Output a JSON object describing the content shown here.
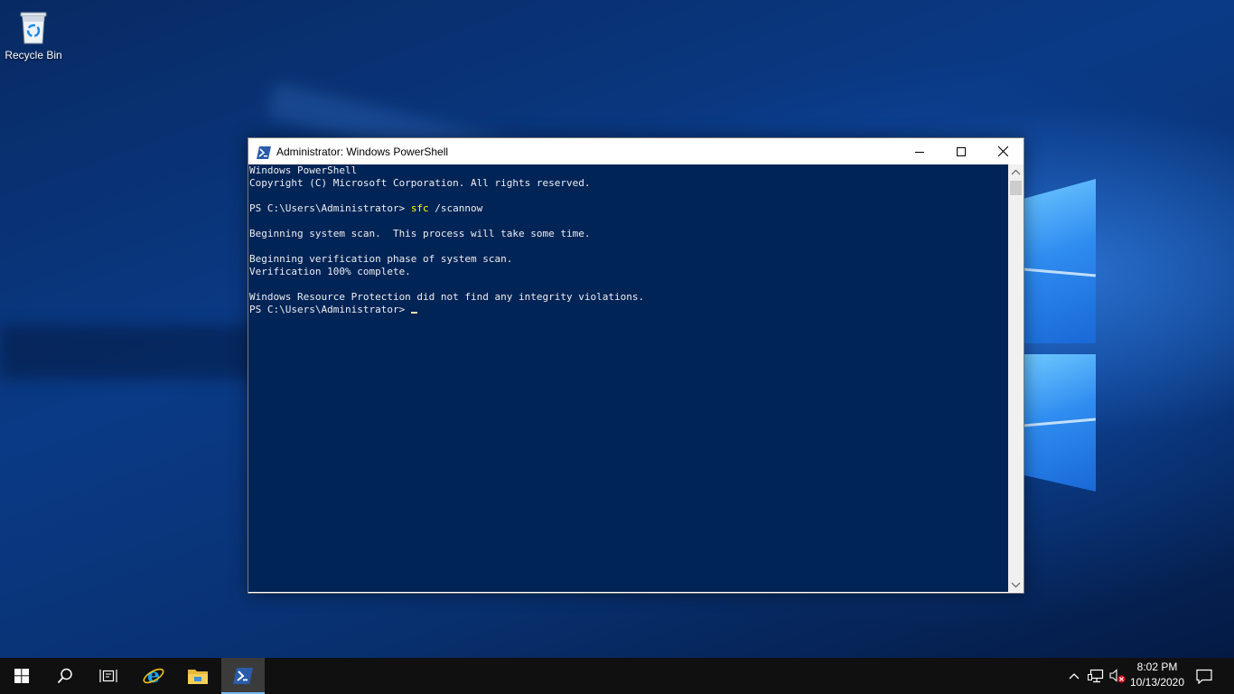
{
  "desktop": {
    "icons": [
      {
        "label": "Recycle Bin",
        "icon": "recycle-bin-icon"
      }
    ]
  },
  "window": {
    "title": "Administrator: Windows PowerShell",
    "icon": "powershell-icon",
    "controls": {
      "minimize": "minimize-icon",
      "maximize": "maximize-icon",
      "close": "close-icon"
    },
    "console": {
      "background": "#012456",
      "foreground": "#eeedf0",
      "command_color": "#ffff00",
      "lines": [
        "Windows PowerShell",
        "Copyright (C) Microsoft Corporation. All rights reserved.",
        "",
        "",
        "",
        "Beginning system scan.  This process will take some time.",
        "",
        "Beginning verification phase of system scan.",
        "Verification 100% complete.",
        "",
        "Windows Resource Protection did not find any integrity violations."
      ],
      "prompt": "PS C:\\Users\\Administrator> ",
      "command_name": "sfc",
      "command_args": " /scannow"
    }
  },
  "taskbar": {
    "buttons": [
      {
        "name": "start-button",
        "icon": "windows-logo-icon"
      },
      {
        "name": "search-button",
        "icon": "search-icon"
      },
      {
        "name": "task-view-button",
        "icon": "task-view-icon"
      },
      {
        "name": "internet-explorer-button",
        "icon": "internet-explorer-icon"
      },
      {
        "name": "file-explorer-button",
        "icon": "file-explorer-icon"
      },
      {
        "name": "powershell-taskbar-button",
        "icon": "powershell-icon",
        "active": true
      }
    ],
    "tray": {
      "icons": [
        "chevron-up-icon",
        "network-icon",
        "volume-muted-icon"
      ],
      "time": "8:02 PM",
      "date": "10/13/2020",
      "notification_icon": "action-center-icon"
    }
  }
}
